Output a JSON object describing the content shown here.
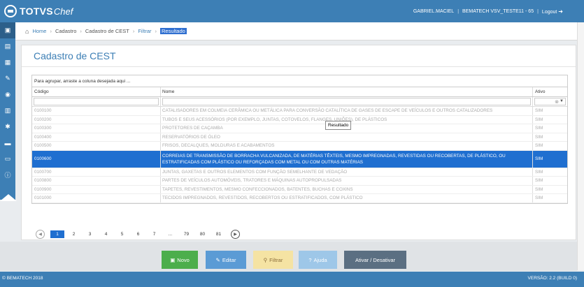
{
  "app": {
    "logo_text": "TOTVS",
    "logo_text2": "Chef",
    "user": "GABRIEL.MACIEL",
    "company": "BEMATECH VSV_TESTE11 - 65",
    "logout": "Logout"
  },
  "breadcrumb": [
    {
      "label": "Home"
    },
    {
      "label": "Cadastro"
    },
    {
      "label": "Cadastro de CEST"
    },
    {
      "label": "Filtrar"
    },
    {
      "label": "Resultado"
    }
  ],
  "page": {
    "title": "Cadastro de CEST"
  },
  "grid": {
    "group_text": "Para agrupar, arraste a coluna desejada aqui ...",
    "columns": [
      "Código",
      "Nome",
      "Ativo"
    ],
    "rows": [
      {
        "codigo": "0100100",
        "nome": "CATALISADORES EM COLMEIA CERÂMICA OU METÁLICA PARA CONVERSÃO CATALÍTICA DE GASES DE ESCAPE DE VEÍCULOS E OUTROS CATALIZADORES",
        "ativo": "SIM"
      },
      {
        "codigo": "0100200",
        "nome": "TUBOS E SEUS ACESSÓRIOS (POR EXEMPLO, JUNTAS, COTOVELOS, FLANGES, UNIÕES), DE PLÁSTICOS",
        "ativo": "SIM"
      },
      {
        "codigo": "0100300",
        "nome": "PROTETORES DE CAÇAMBA",
        "ativo": "SIM"
      },
      {
        "codigo": "0100400",
        "nome": "RESERVATÓRIOS DE ÓLEO",
        "ativo": "SIM"
      },
      {
        "codigo": "0100500",
        "nome": "FRISOS, DECALQUES, MOLDURAS E ACABAMENTOS",
        "ativo": "SIM"
      },
      {
        "codigo": "0100600",
        "nome": "CORREIAS DE TRANSMISSÃO DE BORRACHA VULCANIZADA, DE MATÉRIAS TÊXTEIS, MESMO IMPREGNADAS, REVESTIDAS OU RECOBERTAS, DE PLÁSTICO, OU ESTRATIFICADAS COM PLÁSTICO OU REFORÇADAS COM METAL OU COM OUTRAS MATÉRIAS",
        "ativo": "SIM"
      },
      {
        "codigo": "0100700",
        "nome": "JUNTAS, GAXETAS E OUTROS ELEMENTOS COM FUNÇÃO SEMELHANTE DE VEDAÇÃO",
        "ativo": "SIM"
      },
      {
        "codigo": "0100800",
        "nome": "PARTES DE VEÍCULOS AUTOMÓVEIS, TRATORES E MÁQUINAS AUTOPROPULSADAS",
        "ativo": "SIM"
      },
      {
        "codigo": "0100900",
        "nome": "TAPETES, REVESTIMENTOS, MESMO CONFECCIONADOS, BATENTES, BUCHAS E COXINS",
        "ativo": "SIM"
      },
      {
        "codigo": "0101000",
        "nome": "TECIDOS IMPREGNADOS, REVESTIDOS, RECOBERTOS OU ESTRATIFICADOS, COM PLÁSTICO",
        "ativo": "SIM"
      }
    ],
    "selected_row": 5,
    "tooltip": "Resultado"
  },
  "pager": {
    "pages": [
      "1",
      "2",
      "3",
      "4",
      "5",
      "6",
      "7",
      "...",
      "79",
      "80",
      "81"
    ],
    "active": "1"
  },
  "actions": {
    "novo": "Novo",
    "editar": "Editar",
    "filtrar": "Filtrar",
    "ajuda": "Ajuda",
    "ativar": "Ativar / Desativar"
  },
  "footer": {
    "copyright": "© BEMATECH 2018",
    "version": "VERSÃO: 2.2 (BUILD 0)"
  },
  "colors": {
    "brand": "#3d7fb5",
    "selected": "#1f6fd0",
    "novo": "#4cae4c",
    "editar": "#5b9bd5",
    "filtrar": "#f5e3a3",
    "ajuda": "#9ec7e8",
    "ativar": "#5b6f82"
  }
}
